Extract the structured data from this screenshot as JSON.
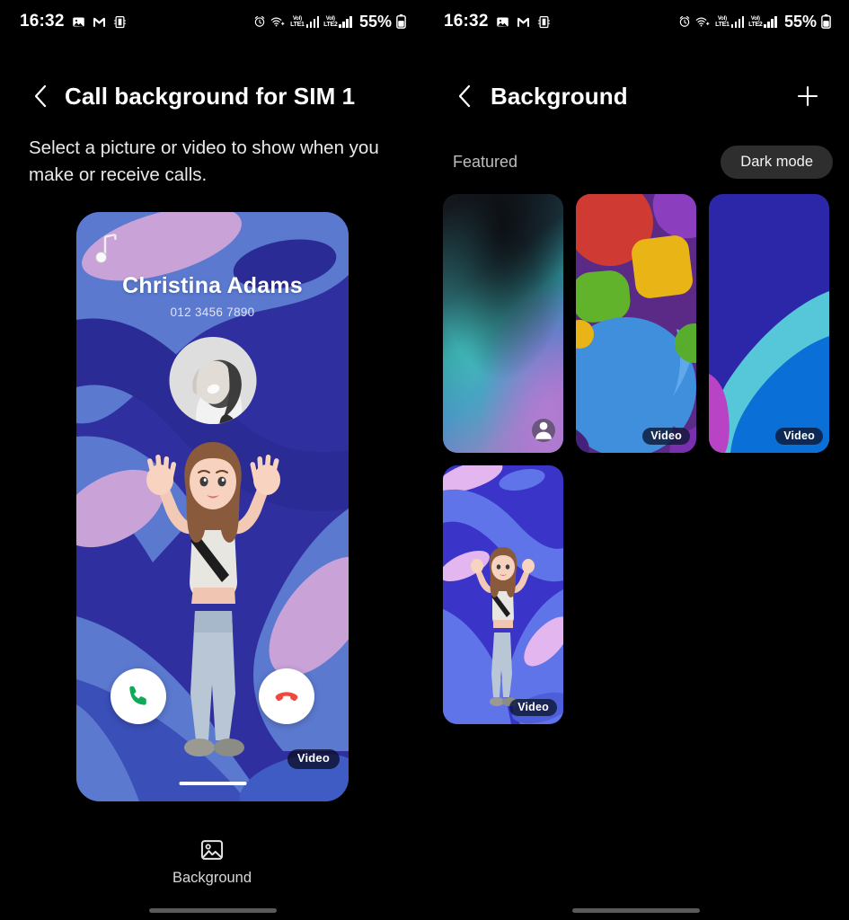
{
  "status_bar": {
    "time": "16:32",
    "battery_percent": "55%",
    "left_icons": [
      "gallery-icon",
      "gmail-icon",
      "screen-recorder-icon"
    ],
    "right_icons": [
      "alarm-icon",
      "wifi-calling-icon",
      "volte-sim1-icon",
      "signal-sim1-icon",
      "volte-sim2-icon",
      "signal-sim2-icon",
      "battery-icon"
    ],
    "sim1_label_top": "VoI)",
    "sim1_label_bottom": "LTE1",
    "sim2_label_top": "VoI)",
    "sim2_label_bottom": "LTE2"
  },
  "left_panel": {
    "header": {
      "back_icon": "chevron-left-icon",
      "title": "Call background for SIM 1"
    },
    "description": "Select a picture or video to show when you make or receive calls.",
    "preview": {
      "ringtone_icon": "music-note-icon",
      "contact_name": "Christina Adams",
      "contact_number": "012 3456 7890",
      "avatar_icon": "contact-photo",
      "accept_icon": "phone-icon",
      "decline_icon": "phone-hangup-icon",
      "media_badge": "Video",
      "home_indicator": "home-indicator"
    },
    "bottom_button": {
      "icon": "image-icon",
      "label": "Background"
    }
  },
  "right_panel": {
    "header": {
      "back_icon": "chevron-left-icon",
      "title": "Background",
      "add_icon": "plus-icon"
    },
    "section_label": "Featured",
    "dark_mode_button": "Dark mode",
    "items": [
      {
        "name": "gradient-blur-background",
        "badge": "",
        "badge_icon": "person-icon",
        "type": "image"
      },
      {
        "name": "colorful-3d-shapes-background",
        "badge": "Video",
        "badge_icon": "",
        "type": "video"
      },
      {
        "name": "abstract-curves-background",
        "badge": "Video",
        "badge_icon": "",
        "type": "video"
      },
      {
        "name": "ar-emoji-background",
        "badge": "Video",
        "badge_icon": "",
        "type": "video"
      }
    ]
  },
  "colors": {
    "background": "#000000",
    "text_primary": "#ffffff",
    "text_secondary": "#bdbdbd",
    "pill_background": "#2e2e2e",
    "accept_green": "#0fa958",
    "decline_red": "#f0483e",
    "preview_deep_blue": "#2b2f9e",
    "preview_mid_blue": "#5570c9",
    "preview_pink": "#cfa0d6"
  }
}
